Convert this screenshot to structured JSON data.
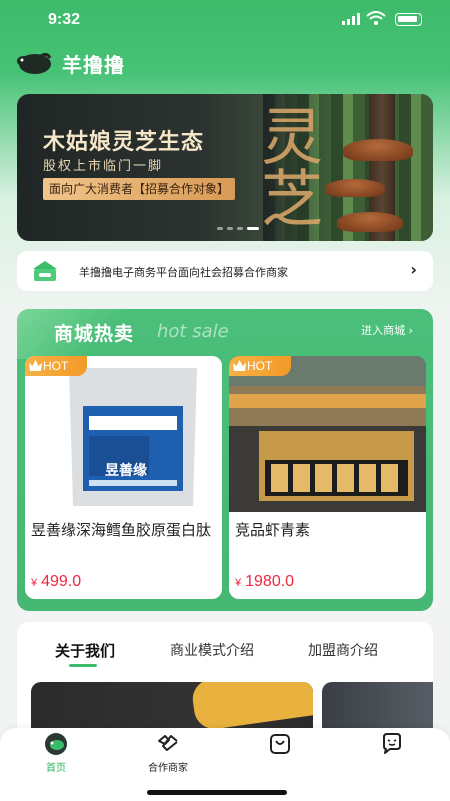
{
  "status_bar": {
    "time": "9:32"
  },
  "app": {
    "title": "羊撸撸"
  },
  "banner": {
    "title": "木姑娘灵芝生态",
    "subtitle": "股权上市临门一脚",
    "tag": "面向广大消费者【招募合作对象】",
    "calligraphy": "灵芝"
  },
  "notice": {
    "text": "羊撸撸电子商务平台面向社会招募合作商家"
  },
  "hot_sale": {
    "title": "商城热卖",
    "subtitle": "hot sale",
    "more_label": "进入商城 ›",
    "badge": "HOT",
    "products": [
      {
        "name": "昱善缘深海鳕鱼胶原蛋白肽",
        "currency": "¥",
        "price": "499.0",
        "pack_label": "昱善缘"
      },
      {
        "name": "竞品虾青素",
        "currency": "¥",
        "price": "1980.0"
      }
    ]
  },
  "about": {
    "tabs": [
      "关于我们",
      "商业模式介绍",
      "加盟商介绍"
    ]
  },
  "tab_bar": {
    "items": [
      {
        "label": "首页",
        "icon": "home-icon",
        "active": true
      },
      {
        "label": "合作商家",
        "icon": "handshake-icon",
        "active": false
      },
      {
        "label": "",
        "icon": "shopping-bag-icon",
        "active": false
      },
      {
        "label": "",
        "icon": "message-icon",
        "active": false
      }
    ]
  },
  "colors": {
    "accent": "#3cbc6b",
    "price": "#ee2740",
    "hot_badge": "#f29a27"
  }
}
